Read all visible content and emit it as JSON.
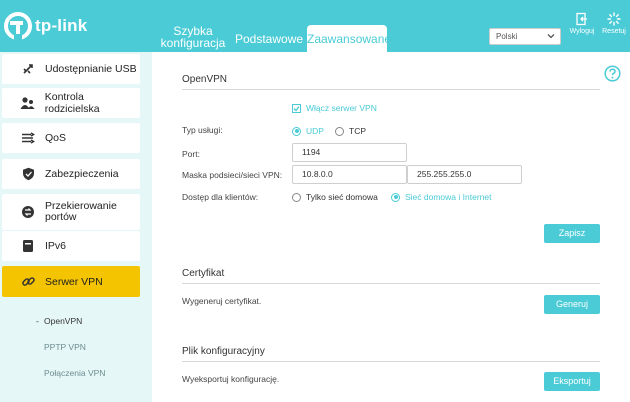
{
  "header": {
    "logo_text": "tp-link",
    "tabs": [
      {
        "label_line1": "Szybka",
        "label_line2": "konfiguracja"
      },
      {
        "label": "Podstawowe"
      },
      {
        "label": "Zaawansowane"
      }
    ],
    "language": "Polski",
    "logout_label": "Wyloguj",
    "reset_label": "Resetuj"
  },
  "sidebar": {
    "items": [
      {
        "label": "Udostępnianie USB"
      },
      {
        "label": "Kontrola rodzicielska"
      },
      {
        "label": "QoS"
      },
      {
        "label": "Zabezpieczenia"
      },
      {
        "label_line1": "Przekierowanie",
        "label_line2": "portów"
      },
      {
        "label": "IPv6"
      },
      {
        "label": "Serwer VPN"
      }
    ],
    "subitems": [
      {
        "label": "OpenVPN"
      },
      {
        "label": "PPTP VPN"
      },
      {
        "label": "Połączenia VPN"
      }
    ]
  },
  "openvpn": {
    "title": "OpenVPN",
    "enable_label": "Włącz serwer VPN",
    "service_type_label": "Typ usługi:",
    "udp_label": "UDP",
    "tcp_label": "TCP",
    "port_label": "Port:",
    "port_value": "1194",
    "subnet_label": "Maska podsieci/sieci VPN:",
    "subnet_value": "10.8.0.0",
    "mask_value": "255.255.255.0",
    "access_label": "Dostęp dla klientów:",
    "home_only_label": "Tylko sieć domowa",
    "home_internet_label": "Sieć domowa i Internet",
    "save_label": "Zapisz"
  },
  "certificate": {
    "title": "Certyfikat",
    "desc": "Wygeneruj certyfikat.",
    "generate_label": "Generuj"
  },
  "config_file": {
    "title": "Plik konfiguracyjny",
    "desc": "Wyeksportuj konfigurację.",
    "export_label": "Eksportuj"
  },
  "colors": {
    "accent": "#4acbd6",
    "active_menu": "#f5c400"
  }
}
